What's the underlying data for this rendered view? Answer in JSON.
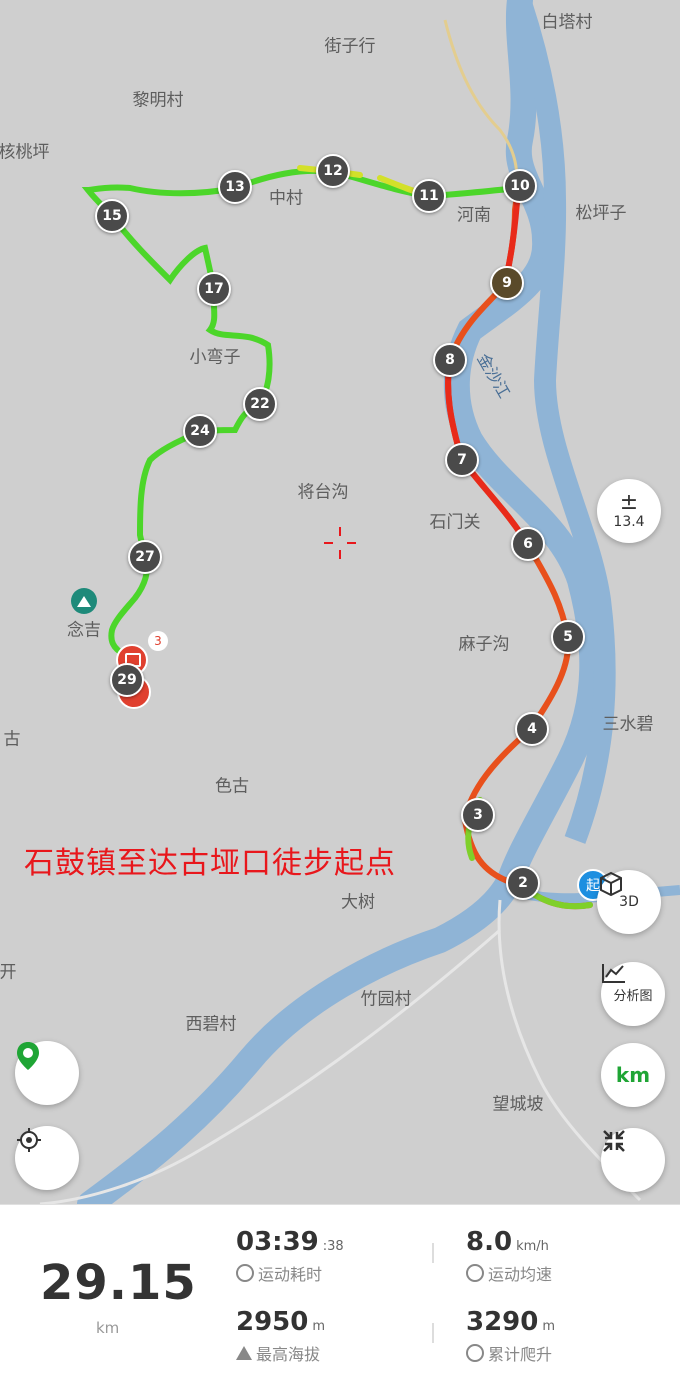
{
  "map": {
    "places": [
      {
        "name": "白塔村"
      },
      {
        "name": "街子行"
      },
      {
        "name": "黎明村"
      },
      {
        "name": "核桃坪"
      },
      {
        "name": "中村"
      },
      {
        "name": "河南"
      },
      {
        "name": "松坪子"
      },
      {
        "name": "小弯子"
      },
      {
        "name": "将台沟"
      },
      {
        "name": "石门关"
      },
      {
        "name": "念吉"
      },
      {
        "name": "麻子沟"
      },
      {
        "name": "三水碧"
      },
      {
        "name": "古"
      },
      {
        "name": "色古"
      },
      {
        "name": "大树"
      },
      {
        "name": "开"
      },
      {
        "name": "竹园村"
      },
      {
        "name": "西碧村"
      },
      {
        "name": "望城坡"
      },
      {
        "name": "金沙江"
      }
    ],
    "km_markers": [
      "2",
      "3",
      "4",
      "5",
      "6",
      "7",
      "8",
      "9",
      "10",
      "11",
      "12",
      "13",
      "15",
      "17",
      "22",
      "24",
      "27",
      "29"
    ],
    "photo_count": "3",
    "start_label": "起",
    "title": "石鼓镇至达古垭口徒步起点",
    "colors": {
      "map_bg": "#cfcfcf",
      "river": "#8fb4d6",
      "route_fast": "#4cd62a",
      "route_slow": "#e82a1a",
      "title": "#e8171c",
      "accent_green": "#1fa535"
    }
  },
  "controls": {
    "zoom_symbol": "±",
    "zoom_level": "13.4",
    "view_3d": "3D",
    "analysis": "分析图",
    "unit_toggle": "km"
  },
  "stats": {
    "distance": "29.15",
    "distance_unit": "km",
    "duration": "03:39",
    "duration_seconds": ":38",
    "duration_label": "运动耗时",
    "avg_speed": "8.0",
    "avg_speed_unit": "km/h",
    "avg_speed_label": "运动均速",
    "max_altitude": "2950",
    "max_altitude_unit": "m",
    "max_altitude_label": "最高海拔",
    "total_climb": "3290",
    "total_climb_unit": "m",
    "total_climb_label": "累计爬升"
  }
}
